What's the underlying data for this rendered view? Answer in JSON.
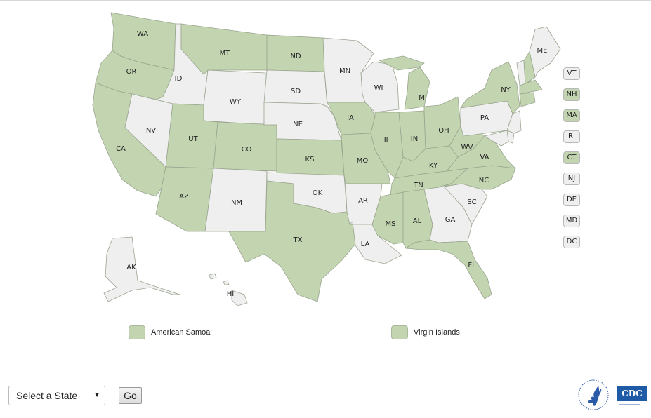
{
  "colors": {
    "highlight": "#c3d4b0",
    "default": "#efefef",
    "stroke": "#9aa58f"
  },
  "states": [
    {
      "id": "WA",
      "label": "WA",
      "active": true
    },
    {
      "id": "OR",
      "label": "OR",
      "active": true
    },
    {
      "id": "CA",
      "label": "CA",
      "active": true
    },
    {
      "id": "ID",
      "label": "ID",
      "active": false
    },
    {
      "id": "NV",
      "label": "NV",
      "active": false
    },
    {
      "id": "MT",
      "label": "MT",
      "active": true
    },
    {
      "id": "WY",
      "label": "WY",
      "active": false
    },
    {
      "id": "UT",
      "label": "UT",
      "active": true
    },
    {
      "id": "AZ",
      "label": "AZ",
      "active": true
    },
    {
      "id": "CO",
      "label": "CO",
      "active": true
    },
    {
      "id": "NM",
      "label": "NM",
      "active": false
    },
    {
      "id": "ND",
      "label": "ND",
      "active": true
    },
    {
      "id": "SD",
      "label": "SD",
      "active": false
    },
    {
      "id": "NE",
      "label": "NE",
      "active": false
    },
    {
      "id": "KS",
      "label": "KS",
      "active": true
    },
    {
      "id": "OK",
      "label": "OK",
      "active": false
    },
    {
      "id": "TX",
      "label": "TX",
      "active": true
    },
    {
      "id": "MN",
      "label": "MN",
      "active": false
    },
    {
      "id": "IA",
      "label": "IA",
      "active": true
    },
    {
      "id": "MO",
      "label": "MO",
      "active": true
    },
    {
      "id": "AR",
      "label": "AR",
      "active": false
    },
    {
      "id": "LA",
      "label": "LA",
      "active": false
    },
    {
      "id": "WI",
      "label": "WI",
      "active": false
    },
    {
      "id": "IL",
      "label": "IL",
      "active": true
    },
    {
      "id": "MI",
      "label": "MI",
      "active": true
    },
    {
      "id": "IN",
      "label": "IN",
      "active": true
    },
    {
      "id": "OH",
      "label": "OH",
      "active": true
    },
    {
      "id": "KY",
      "label": "KY",
      "active": true
    },
    {
      "id": "TN",
      "label": "TN",
      "active": true
    },
    {
      "id": "MS",
      "label": "MS",
      "active": true
    },
    {
      "id": "AL",
      "label": "AL",
      "active": true
    },
    {
      "id": "GA",
      "label": "GA",
      "active": false
    },
    {
      "id": "FL",
      "label": "FL",
      "active": true
    },
    {
      "id": "SC",
      "label": "SC",
      "active": false
    },
    {
      "id": "NC",
      "label": "NC",
      "active": true
    },
    {
      "id": "VA",
      "label": "VA",
      "active": true
    },
    {
      "id": "WV",
      "label": "WV",
      "active": true
    },
    {
      "id": "PA",
      "label": "PA",
      "active": false
    },
    {
      "id": "NY",
      "label": "NY",
      "active": true
    },
    {
      "id": "ME",
      "label": "ME",
      "active": false
    },
    {
      "id": "VTm",
      "label": "",
      "active": false
    },
    {
      "id": "NHm",
      "label": "",
      "active": true
    },
    {
      "id": "MAm",
      "label": "",
      "active": true
    },
    {
      "id": "CTm",
      "label": "",
      "active": true
    },
    {
      "id": "NJm",
      "label": "",
      "active": false
    },
    {
      "id": "DEm",
      "label": "",
      "active": false
    },
    {
      "id": "MDm",
      "label": "",
      "active": false
    },
    {
      "id": "AK",
      "label": "AK",
      "active": false
    },
    {
      "id": "HI",
      "label": "HI",
      "active": false
    }
  ],
  "small_states": [
    {
      "label": "VT",
      "active": false
    },
    {
      "label": "NH",
      "active": true
    },
    {
      "label": "MA",
      "active": true
    },
    {
      "label": "RI",
      "active": false
    },
    {
      "label": "CT",
      "active": true
    },
    {
      "label": "NJ",
      "active": false
    },
    {
      "label": "DE",
      "active": false
    },
    {
      "label": "MD",
      "active": false
    },
    {
      "label": "DC",
      "active": false
    }
  ],
  "territories": [
    {
      "label": "American Samoa",
      "active": true
    },
    {
      "label": "Virgin Islands",
      "active": true
    }
  ],
  "controls": {
    "select_label": "Select a State",
    "select_arrow": "▼",
    "go_label": "Go"
  },
  "logos": {
    "hhs": "hhs-eagle-logo",
    "cdc": "CDC"
  }
}
